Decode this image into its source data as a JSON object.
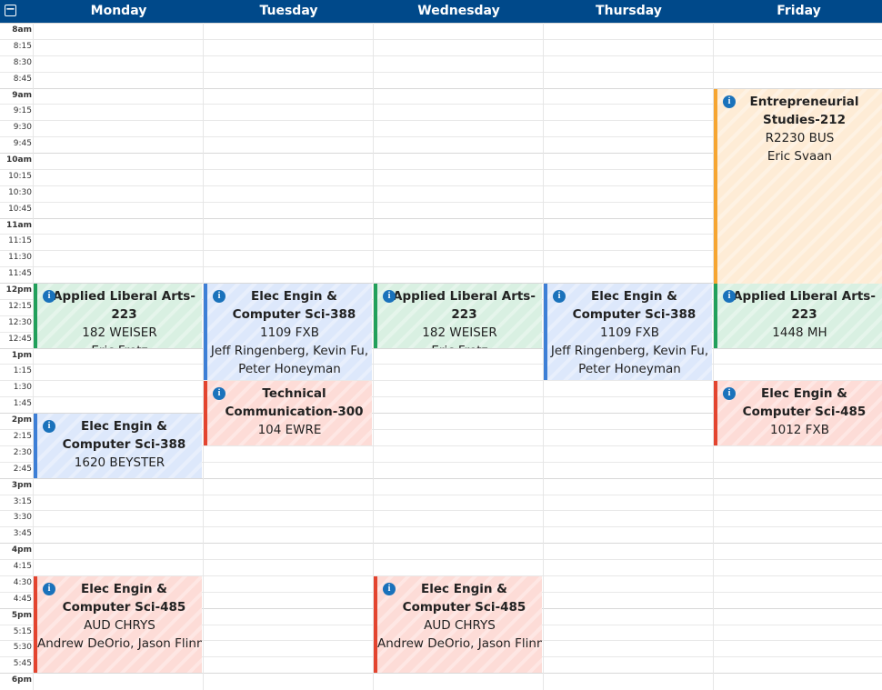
{
  "header": {
    "days": [
      "Monday",
      "Tuesday",
      "Wednesday",
      "Thursday",
      "Friday"
    ],
    "background": "#00498a"
  },
  "times": [
    "8am",
    "8:15",
    "8:30",
    "8:45",
    "9am",
    "9:15",
    "9:30",
    "9:45",
    "10am",
    "10:15",
    "10:30",
    "10:45",
    "11am",
    "11:15",
    "11:30",
    "11:45",
    "12pm",
    "12:15",
    "12:30",
    "12:45",
    "1pm",
    "1:15",
    "1:30",
    "1:45",
    "2pm",
    "2:15",
    "2:30",
    "2:45",
    "3pm",
    "3:15",
    "3:30",
    "3:45",
    "4pm",
    "4:15",
    "4:30",
    "4:45",
    "5pm",
    "5:15",
    "5:30",
    "5:45",
    "6pm"
  ],
  "colors": {
    "green": {
      "border": "#21a05b",
      "fill": "#d9f0e2"
    },
    "blue": {
      "border": "#3d7fd6",
      "fill": "#dde8fb"
    },
    "red": {
      "border": "#e3442f",
      "fill": "#fddcd7"
    },
    "orange": {
      "border": "#f6a531",
      "fill": "#feecd6"
    }
  },
  "events": [
    {
      "day": 0,
      "start": "12pm",
      "end": "12:45",
      "color": "green",
      "title": "Applied Liberal Arts-223",
      "lines": [
        "182 WEISER",
        "Eric Fretz"
      ]
    },
    {
      "day": 0,
      "start": "2pm",
      "end": "2:45",
      "color": "blue",
      "title": "Elec Engin & Computer Sci-388",
      "lines": [
        "1620 BEYSTER"
      ]
    },
    {
      "day": 0,
      "start": "4:30",
      "end": "5:45",
      "color": "red",
      "title": "Elec Engin & Computer Sci-485",
      "lines": [
        "AUD CHRYS",
        "Andrew DeOrio, Jason Flinn"
      ]
    },
    {
      "day": 1,
      "start": "12pm",
      "end": "1:15",
      "color": "blue",
      "title": "Elec Engin & Computer Sci-388",
      "lines": [
        "1109 FXB",
        "Jeff Ringenberg, Kevin Fu,",
        "Peter Honeyman"
      ]
    },
    {
      "day": 1,
      "start": "1:30",
      "end": "2:15",
      "color": "red",
      "title": "Technical Communication-300",
      "lines": [
        "104 EWRE"
      ]
    },
    {
      "day": 2,
      "start": "12pm",
      "end": "12:45",
      "color": "green",
      "title": "Applied Liberal Arts-223",
      "lines": [
        "182 WEISER",
        "Eric Fretz"
      ]
    },
    {
      "day": 2,
      "start": "4:30",
      "end": "5:45",
      "color": "red",
      "title": "Elec Engin & Computer Sci-485",
      "lines": [
        "AUD CHRYS",
        "Andrew DeOrio, Jason Flinn"
      ]
    },
    {
      "day": 3,
      "start": "12pm",
      "end": "1:15",
      "color": "blue",
      "title": "Elec Engin & Computer Sci-388",
      "lines": [
        "1109 FXB",
        "Jeff Ringenberg, Kevin Fu,",
        "Peter Honeyman"
      ]
    },
    {
      "day": 4,
      "start": "9am",
      "end": "11:45",
      "color": "orange",
      "title": "Entrepreneurial Studies-212",
      "lines": [
        "R2230 BUS",
        "Eric Svaan"
      ]
    },
    {
      "day": 4,
      "start": "12pm",
      "end": "12:45",
      "color": "green",
      "title": "Applied Liberal Arts-223",
      "lines": [
        "1448 MH"
      ]
    },
    {
      "day": 4,
      "start": "1:30",
      "end": "2:15",
      "color": "red",
      "title": "Elec Engin & Computer Sci-485",
      "lines": [
        "1012 FXB"
      ]
    }
  ]
}
